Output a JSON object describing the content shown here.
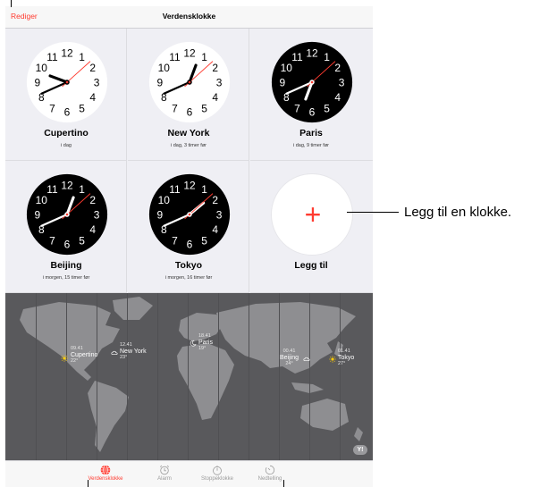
{
  "nav": {
    "edit_label": "Rediger",
    "title": "Verdensklokke"
  },
  "clocks": [
    {
      "city": "Cupertino",
      "sub": "i dag",
      "theme": "light",
      "hour": 9,
      "minute": 41,
      "second": 8
    },
    {
      "city": "New York",
      "sub": "i dag, 3 timer før",
      "theme": "light",
      "hour": 12,
      "minute": 41,
      "second": 8
    },
    {
      "city": "Paris",
      "sub": "i dag, 9 timer før",
      "theme": "dark",
      "hour": 18,
      "minute": 41,
      "second": 8
    },
    {
      "city": "Beijing",
      "sub": "i morgen, 15 timer før",
      "theme": "dark",
      "hour": 0,
      "minute": 41,
      "second": 8
    },
    {
      "city": "Tokyo",
      "sub": "i morgen, 16 timer før",
      "theme": "dark",
      "hour": 1,
      "minute": 41,
      "second": 8
    }
  ],
  "add": {
    "label": "Legg til"
  },
  "map": {
    "cities": [
      {
        "time": "09.41",
        "city": "Cupertino",
        "temp": "22°",
        "weather": "sun"
      },
      {
        "time": "12.41",
        "city": "New York",
        "temp": "23°",
        "weather": "cloud"
      },
      {
        "time": "18.41",
        "city": "Paris",
        "temp": "19°",
        "weather": "moon"
      },
      {
        "time": "00.41",
        "city": "Beijing",
        "temp": "24°",
        "weather": "cloud"
      },
      {
        "time": "01.41",
        "city": "Tokyo",
        "temp": "27°",
        "weather": "sun"
      }
    ],
    "provider_logo": "Y!"
  },
  "tabs": [
    {
      "label": "Verdensklokke",
      "icon": "globe-icon",
      "active": true
    },
    {
      "label": "Alarm",
      "icon": "alarm-clock-icon",
      "active": false
    },
    {
      "label": "Stoppeklokke",
      "icon": "stopwatch-icon",
      "active": false
    },
    {
      "label": "Nedtelling",
      "icon": "timer-icon",
      "active": false
    }
  ],
  "callout": {
    "text": "Legg til en klokke."
  },
  "colors": {
    "accent": "#ff3b30",
    "map": "#59595c",
    "land": "#8e8e91",
    "dark_face": "#000000",
    "light_face": "#ffffff"
  }
}
